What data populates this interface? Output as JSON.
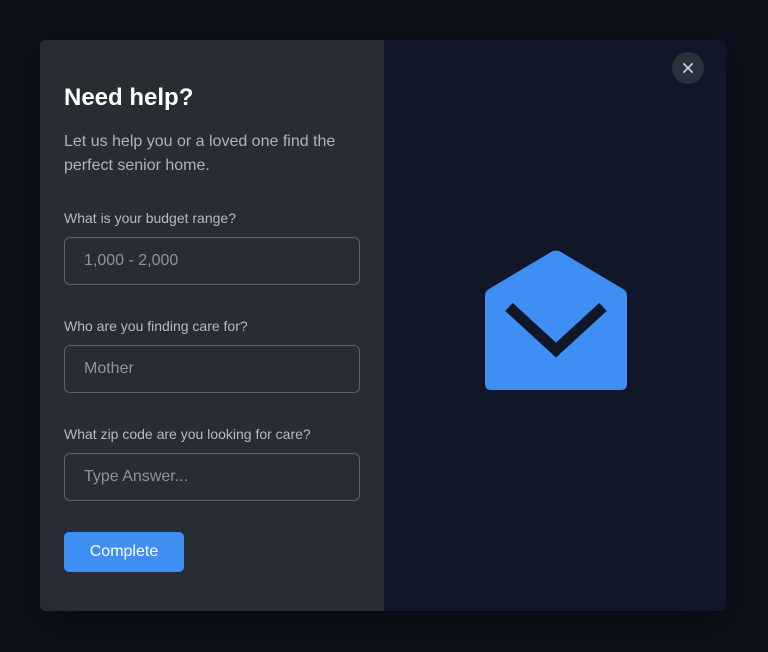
{
  "modal": {
    "title": "Need help?",
    "subtitle": "Let us help you or a loved one find the perfect senior home."
  },
  "form": {
    "budget": {
      "label": "What is your budget range?",
      "placeholder": "1,000 - 2,000"
    },
    "care_for": {
      "label": "Who are you finding care for?",
      "placeholder": "Mother"
    },
    "zip": {
      "label": "What zip code are you looking for care?",
      "placeholder": "Type Answer..."
    },
    "submit_label": "Complete"
  },
  "icons": {
    "close": "close-icon",
    "illustration": "envelope-open-icon"
  },
  "colors": {
    "accent": "#3f8ef4",
    "left_panel": "#282d33",
    "right_panel": "#111729",
    "backdrop": "#0d111c"
  }
}
